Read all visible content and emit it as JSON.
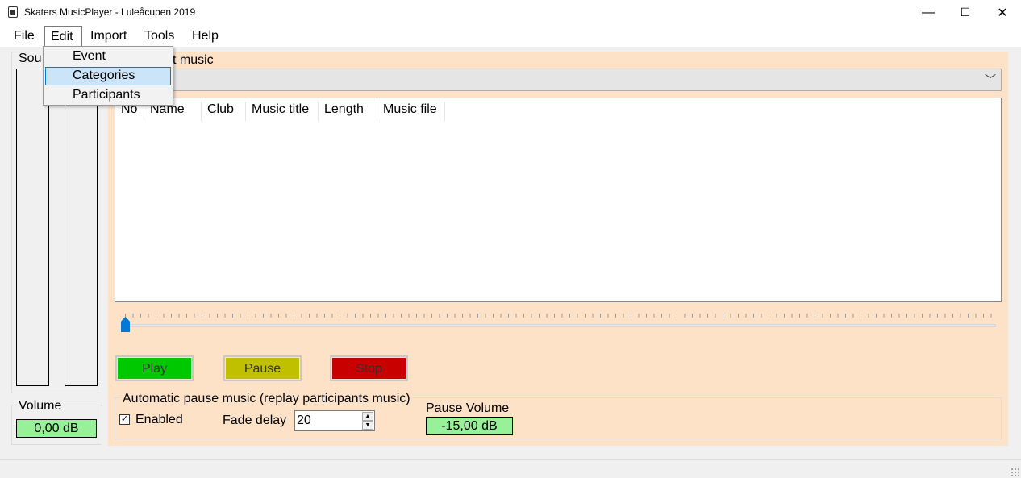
{
  "window": {
    "title": "Skaters MusicPlayer - Luleåcupen 2019",
    "controls": {
      "minimize": "—",
      "maximize": "☐",
      "close": "✕"
    }
  },
  "menubar": {
    "items": [
      "File",
      "Edit",
      "Import",
      "Tools",
      "Help"
    ]
  },
  "edit_menu": {
    "entries": [
      "Event",
      "Categories",
      "Participants"
    ],
    "highlighted": "Categories"
  },
  "sound": {
    "label": "Sou"
  },
  "volume": {
    "label": "Volume",
    "value": "0,00 dB"
  },
  "panel": {
    "label": "t music",
    "dropdown_value": "",
    "columns": [
      "No",
      "Name",
      "Club",
      "Music title",
      "Length",
      "Music file"
    ]
  },
  "slider": {
    "position": 0
  },
  "buttons": {
    "play": "Play",
    "pause": "Pause",
    "stop": "Stop"
  },
  "auto_pause": {
    "label": "Automatic pause music (replay participants music)",
    "enabled_label": "Enabled",
    "enabled": true,
    "fade_label": "Fade delay",
    "fade_value": "20",
    "pause_volume_label": "Pause Volume",
    "pause_volume_value": "-15,00 dB"
  },
  "colors": {
    "panel_bg": "#fde2c8",
    "play": "#00c800",
    "pause": "#c0c000",
    "stop": "#c80000",
    "db_box": "#98f098",
    "accent": "#0078d7"
  }
}
